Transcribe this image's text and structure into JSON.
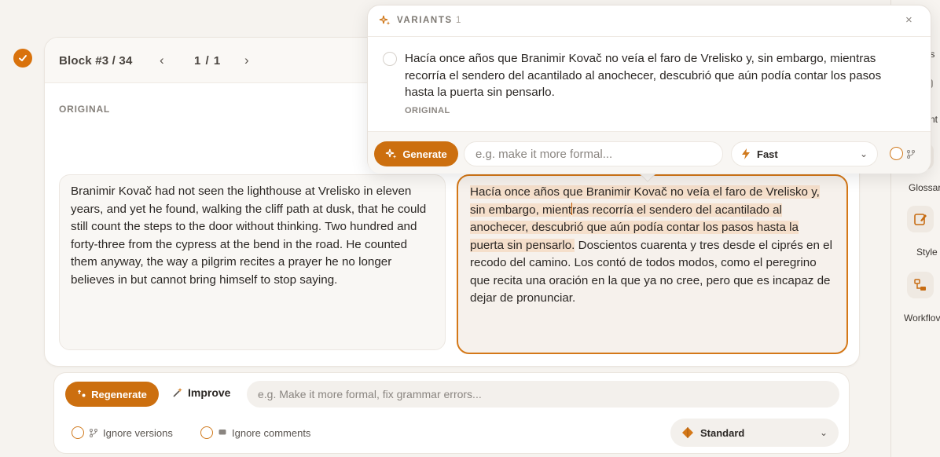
{
  "sidebar": {
    "items": [
      {
        "label": "ts",
        "icon": "document-icon"
      },
      {
        "label": "nt",
        "icon": "comment-icon"
      },
      {
        "label": "Glossar",
        "icon": "book-icon"
      },
      {
        "label": "Style",
        "icon": "pencil-square-icon"
      },
      {
        "label": "Workflov",
        "icon": "workflow-icon"
      }
    ]
  },
  "block": {
    "label": "Block #3 / 34",
    "page_indicator": "1 / 1",
    "original_label": "ORIGINAL",
    "source_text": "Branimir Kovač had not seen the lighthouse at Vrelisko in eleven years, and yet he found, walking the cliff path at dusk, that he could still count the steps to the door without thinking. Two hundred and forty-three from the cypress at the bend in the road. He counted them anyway, the way a pilgrim recites a prayer he no longer believes in but cannot bring himself to stop saying.",
    "target_highlighted_a": "Hacía once años que Branimir Kovač no veía el faro de Vrelisko y, sin embargo, mient",
    "target_highlighted_b": "ras recorría el sendero del acantilado al anochecer, descubrió que aún podía contar los pasos hasta la puerta sin pensarlo.",
    "target_rest": " Doscientos cuarenta y tres desde el ciprés en el recodo del camino. Los contó de todos modos, como el peregrino que recita una oración en la que ya no cree, pero que es incapaz de dejar de pronunciar."
  },
  "variants_popup": {
    "title": "VARIANTS",
    "count": "1",
    "variant_text": "Hacía once años que Branimir Kovač no veía el faro de Vrelisko y, sin embargo, mientras recorría el sendero del acantilado al anochecer, descubrió que aún podía contar los pasos hasta la puerta sin pensarlo.",
    "variant_tag": "ORIGINAL",
    "generate_label": "Generate",
    "input_placeholder": "e.g. make it more formal...",
    "speed_label": "Fast"
  },
  "toolbar": {
    "regenerate_label": "Regenerate",
    "improve_label": "Improve",
    "improve_placeholder": "e.g. Make it more formal, fix grammar errors...",
    "ignore_versions_label": "Ignore versions",
    "ignore_comments_label": "Ignore comments",
    "quality_label": "Standard"
  },
  "colors": {
    "accent": "#cc6f0f",
    "highlight": "#f5dfcb",
    "background": "#f6f3ef"
  }
}
